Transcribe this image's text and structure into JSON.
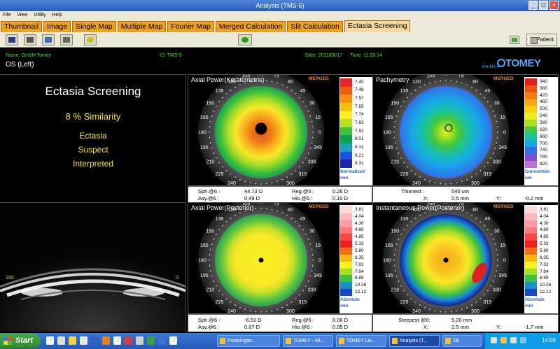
{
  "window": {
    "title": "Analysis (TMS-5)"
  },
  "menu": [
    "File",
    "View",
    "Utility",
    "Help"
  ],
  "tabs": [
    {
      "label": "Thumbnail",
      "active": false
    },
    {
      "label": "Image",
      "active": false
    },
    {
      "label": "Single Map",
      "active": false
    },
    {
      "label": "Multiple Map",
      "active": false
    },
    {
      "label": "Fourier Map",
      "active": false
    },
    {
      "label": "Merged Calculation",
      "active": false
    },
    {
      "label": "Slit Calculation",
      "active": false
    },
    {
      "label": "Ectasia Screening",
      "active": true
    }
  ],
  "toolbar": {
    "patient_label": "Patient"
  },
  "header": {
    "name": "Name: GmbH Tomey",
    "id": "ID: TMS-5",
    "date": "Date: 2011/08/17",
    "time": "Time: 11:28:14",
    "eye": "OS (Left)",
    "version": "Ver.6H.4",
    "brand": "TOMEY"
  },
  "result": {
    "title": "Ectasia Screening",
    "similarity": "8 % Similarity",
    "lines": [
      "Ectasia",
      "Suspect",
      "Interpreted"
    ]
  },
  "scheimpflug": {
    "left_label": "180",
    "right_label": "0"
  },
  "maps": {
    "axial_ant": {
      "title": "Axial Power(Keratometric)",
      "badge": "MERGED",
      "scale": [
        "7.40",
        "7.48",
        "7.57",
        "7.65",
        "7.74",
        "7.83",
        "7.92",
        "8.01",
        "8.11",
        "8.21",
        "8.31"
      ],
      "scale_colors": [
        "#e82828",
        "#f05a10",
        "#f88e10",
        "#f8c010",
        "#f8f020",
        "#b8e020",
        "#40c040",
        "#10a050",
        "#18a0b8",
        "#2050e0",
        "#1828a8"
      ],
      "footer": [
        "Normalized",
        "mm"
      ]
    },
    "pachy": {
      "title": "Pachymetry",
      "badge": "MERGED",
      "scale": [
        "340",
        "380",
        "420",
        "460",
        "500",
        "540",
        "580",
        "620",
        "660",
        "700",
        "740",
        "780",
        "820"
      ],
      "scale_colors": [
        "#e02020",
        "#f05010",
        "#f87c10",
        "#f8a810",
        "#f8d010",
        "#e8f020",
        "#a8e020",
        "#40c840",
        "#18c0a8",
        "#18a8e8",
        "#3070e8",
        "#8050d0",
        "#c070d0"
      ],
      "footer": [
        "Convention",
        "um"
      ]
    },
    "axial_post": {
      "title": "Axial Power(Posterior)",
      "badge": "MERGED",
      "scale": [
        "3.81",
        "4.04",
        "4.30",
        "4.60",
        "4.95",
        "5.33",
        "5.80",
        "6.35",
        "7.02",
        "7.84",
        "8.89",
        "10.26",
        "12.12"
      ],
      "scale_colors": [
        "#ffd8d8",
        "#ffb8c0",
        "#ff9aa0",
        "#ff7878",
        "#f84848",
        "#f02020",
        "#f07010",
        "#f8b810",
        "#f8f020",
        "#a8e020",
        "#40c040",
        "#1890c8",
        "#1848c0"
      ],
      "footer": [
        "Absolute",
        "mm"
      ]
    },
    "inst_post": {
      "title": "Instantaneous Power(Posterior)",
      "badge": "MERGED",
      "scale": [
        "3.81",
        "4.04",
        "4.30",
        "4.60",
        "4.95",
        "5.33",
        "5.80",
        "6.35",
        "7.02",
        "7.84",
        "8.89",
        "10.26",
        "12.12"
      ],
      "scale_colors": [
        "#ffd8d8",
        "#ffb8c0",
        "#ff9aa0",
        "#ff7878",
        "#f84848",
        "#f02020",
        "#f07010",
        "#f8b810",
        "#f8f020",
        "#a8e020",
        "#40c040",
        "#1890c8",
        "#1848c0"
      ],
      "footer": [
        "Absolute",
        "mm"
      ]
    }
  },
  "angle_labels": [
    "105",
    "90",
    "75",
    "120",
    "60",
    "135",
    "45",
    "150",
    "30",
    "165",
    "15",
    "0",
    "180",
    "345",
    "195",
    "330",
    "210",
    "315",
    "225",
    "300",
    "240",
    "285",
    "255",
    "270"
  ],
  "stats": {
    "axial_ant": {
      "sph_label": "Sph.@6 :",
      "sph": "44.73 D",
      "reg_label": "Reg.@6 :",
      "reg": "0.26 D",
      "asy_label": "Asy.@6 :",
      "asy": "0.49 D",
      "hio_label": "Hio.@6 :",
      "hio": "0.10 D"
    },
    "pachy": {
      "thin_label": "Thinnest :",
      "thin": "540 um",
      "x_label": "X:",
      "x": "0.5 mm",
      "y_label": "Y:",
      "y": "-0.2 mm"
    },
    "axial_post": {
      "sph_label": "Sph.@6 :",
      "sph": "-6.51 D",
      "reg_label": "Reg.@6 :",
      "reg": "0.06 D",
      "asy_label": "Asy.@6 :",
      "asy": "0.07 D",
      "hio_label": "Hio.@6 :",
      "hio": "0.05 D"
    },
    "inst_post": {
      "steep_label": "Steepest @6:",
      "steep": "5.20 mm",
      "x_label": "X:",
      "x": "2.5 mm",
      "y_label": "Y:",
      "y": "-1.7 mm"
    }
  },
  "taskbar": {
    "start": "Start",
    "tasks": [
      {
        "label": "Posteingan..."
      },
      {
        "label": "TOMEY - Mi..."
      },
      {
        "label": "TOMEY Lin..."
      },
      {
        "label": "Analysis (T..."
      },
      {
        "label": "DE"
      }
    ],
    "clock": "14:05"
  }
}
